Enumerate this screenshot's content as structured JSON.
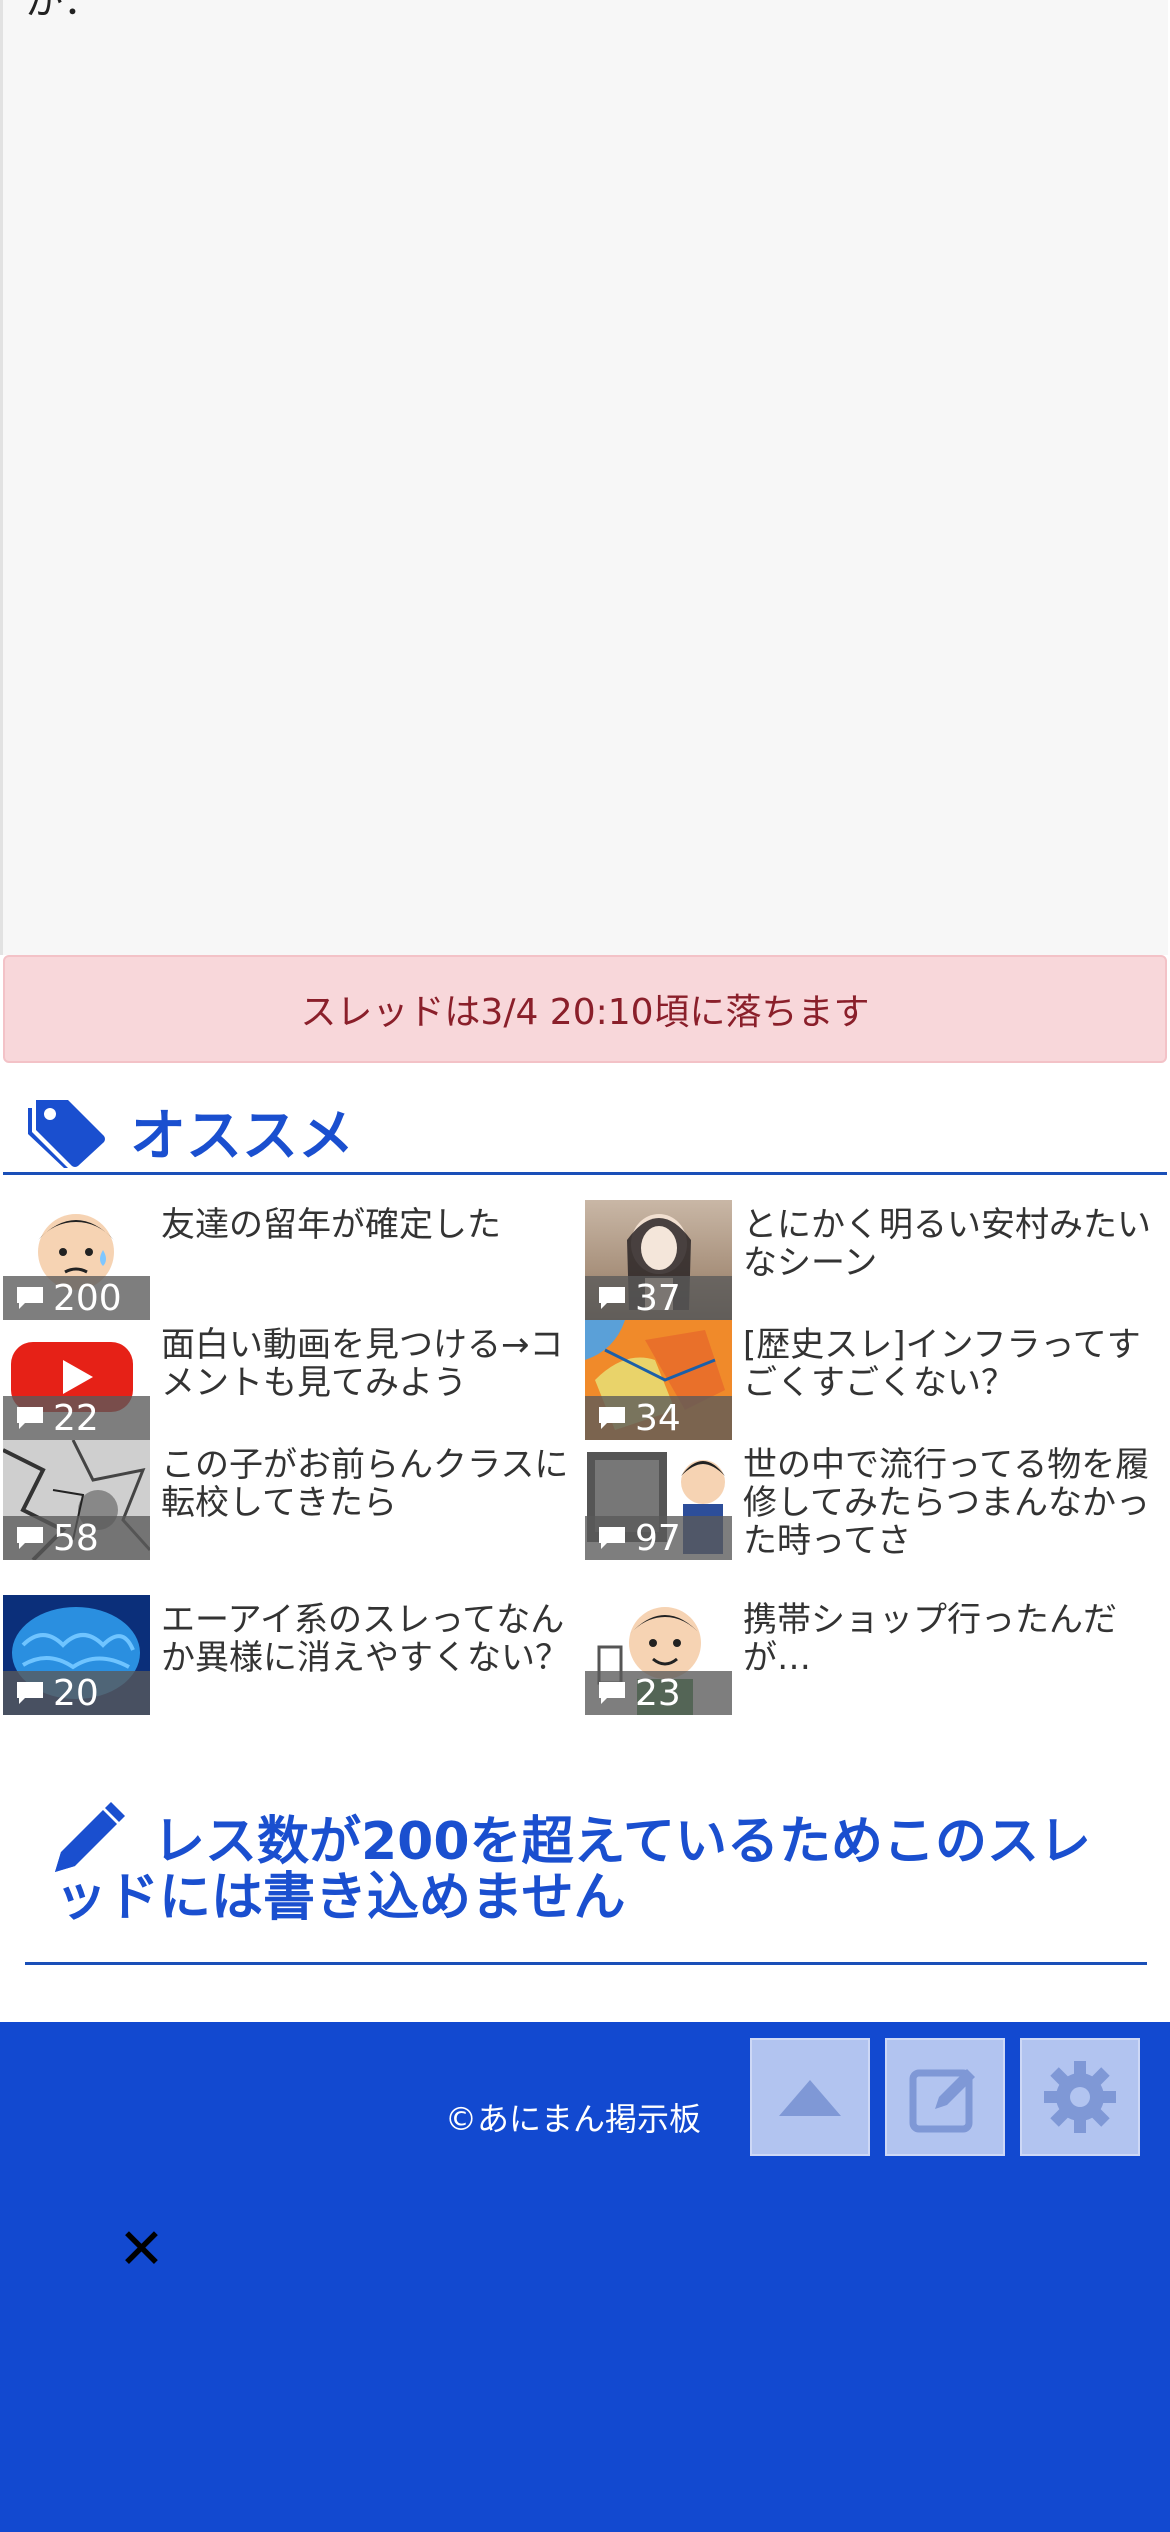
{
  "top": {
    "cut_text": "か："
  },
  "alert": {
    "text": "スレッドは3/4 20:10頃に落ちます"
  },
  "recommend": {
    "title": "オススメ",
    "items": [
      {
        "title": "友達の留年が確定した",
        "count": "200",
        "thumb": "worried-man-icon"
      },
      {
        "title": "とにかく明るい安村みたいなシーン",
        "count": "37",
        "thumb": "anime-girl-image"
      },
      {
        "title": "面白い動画を見つける→コメントも見てみよう",
        "count": "22",
        "thumb": "youtube-play-icon"
      },
      {
        "title": "[歴史スレ]インフラってすごくすごくない？",
        "count": "34",
        "thumb": "map-image"
      },
      {
        "title": "この子がお前らんクラスに転校してきたら",
        "count": "58",
        "thumb": "manga-panel-image"
      },
      {
        "title": "世の中で流行ってる物を履修してみたらつまんなかった時ってさ",
        "count": "97",
        "thumb": "man-with-tv-icon"
      },
      {
        "title": "エーアイ系のスレってなんか異様に消えやすくない？",
        "count": "20",
        "thumb": "blue-brain-image"
      },
      {
        "title": "携帯ショップ行ったんだが…",
        "count": "23",
        "thumb": "smiling-man-icon"
      }
    ]
  },
  "write_notice": {
    "title": "レス数が200を超えているためこのスレッドには書き込めません"
  },
  "footer": {
    "copyright": "©あにまん掲示板",
    "close_glyph": "✕"
  },
  "colors": {
    "accent": "#1a4fcf",
    "footer_bg": "#1249d0",
    "alert_bg": "#f8d7da",
    "alert_text": "#8a1f2a"
  }
}
